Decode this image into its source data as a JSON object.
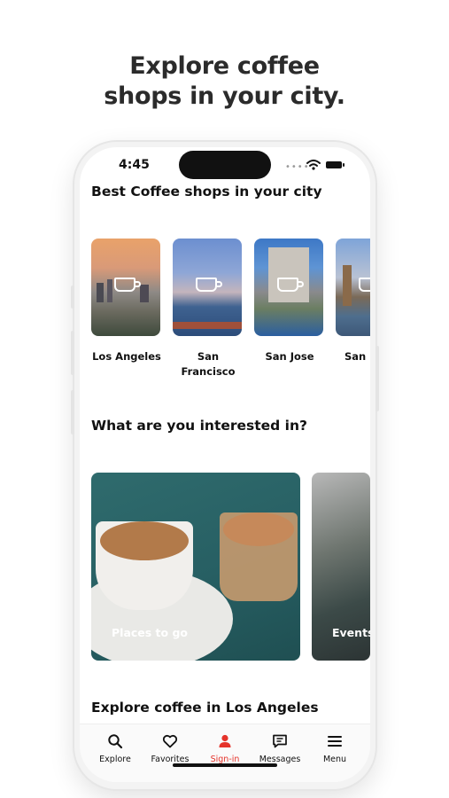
{
  "headline": {
    "line1": "Explore coffee",
    "line2": "shops in your city."
  },
  "status": {
    "time": "4:45"
  },
  "sections": {
    "best": "Best Coffee shops in your city",
    "interests": "What are you interested in?",
    "explore": "Explore coffee in Los Angeles"
  },
  "cities": [
    {
      "line1": "Los Angeles",
      "line2": ""
    },
    {
      "line1": "San",
      "line2": "Francisco"
    },
    {
      "line1": "San Jose",
      "line2": ""
    },
    {
      "line1": "San D",
      "line2": ""
    }
  ],
  "interests": [
    {
      "label": "Places to go"
    },
    {
      "label": "Events"
    }
  ],
  "tabs": [
    {
      "label": "Explore",
      "icon": "search-icon"
    },
    {
      "label": "Favorites",
      "icon": "heart-icon"
    },
    {
      "label": "Sign-in",
      "icon": "person-icon"
    },
    {
      "label": "Messages",
      "icon": "message-icon"
    },
    {
      "label": "Menu",
      "icon": "menu-icon"
    }
  ],
  "colors": {
    "accent": "#e5332a"
  }
}
